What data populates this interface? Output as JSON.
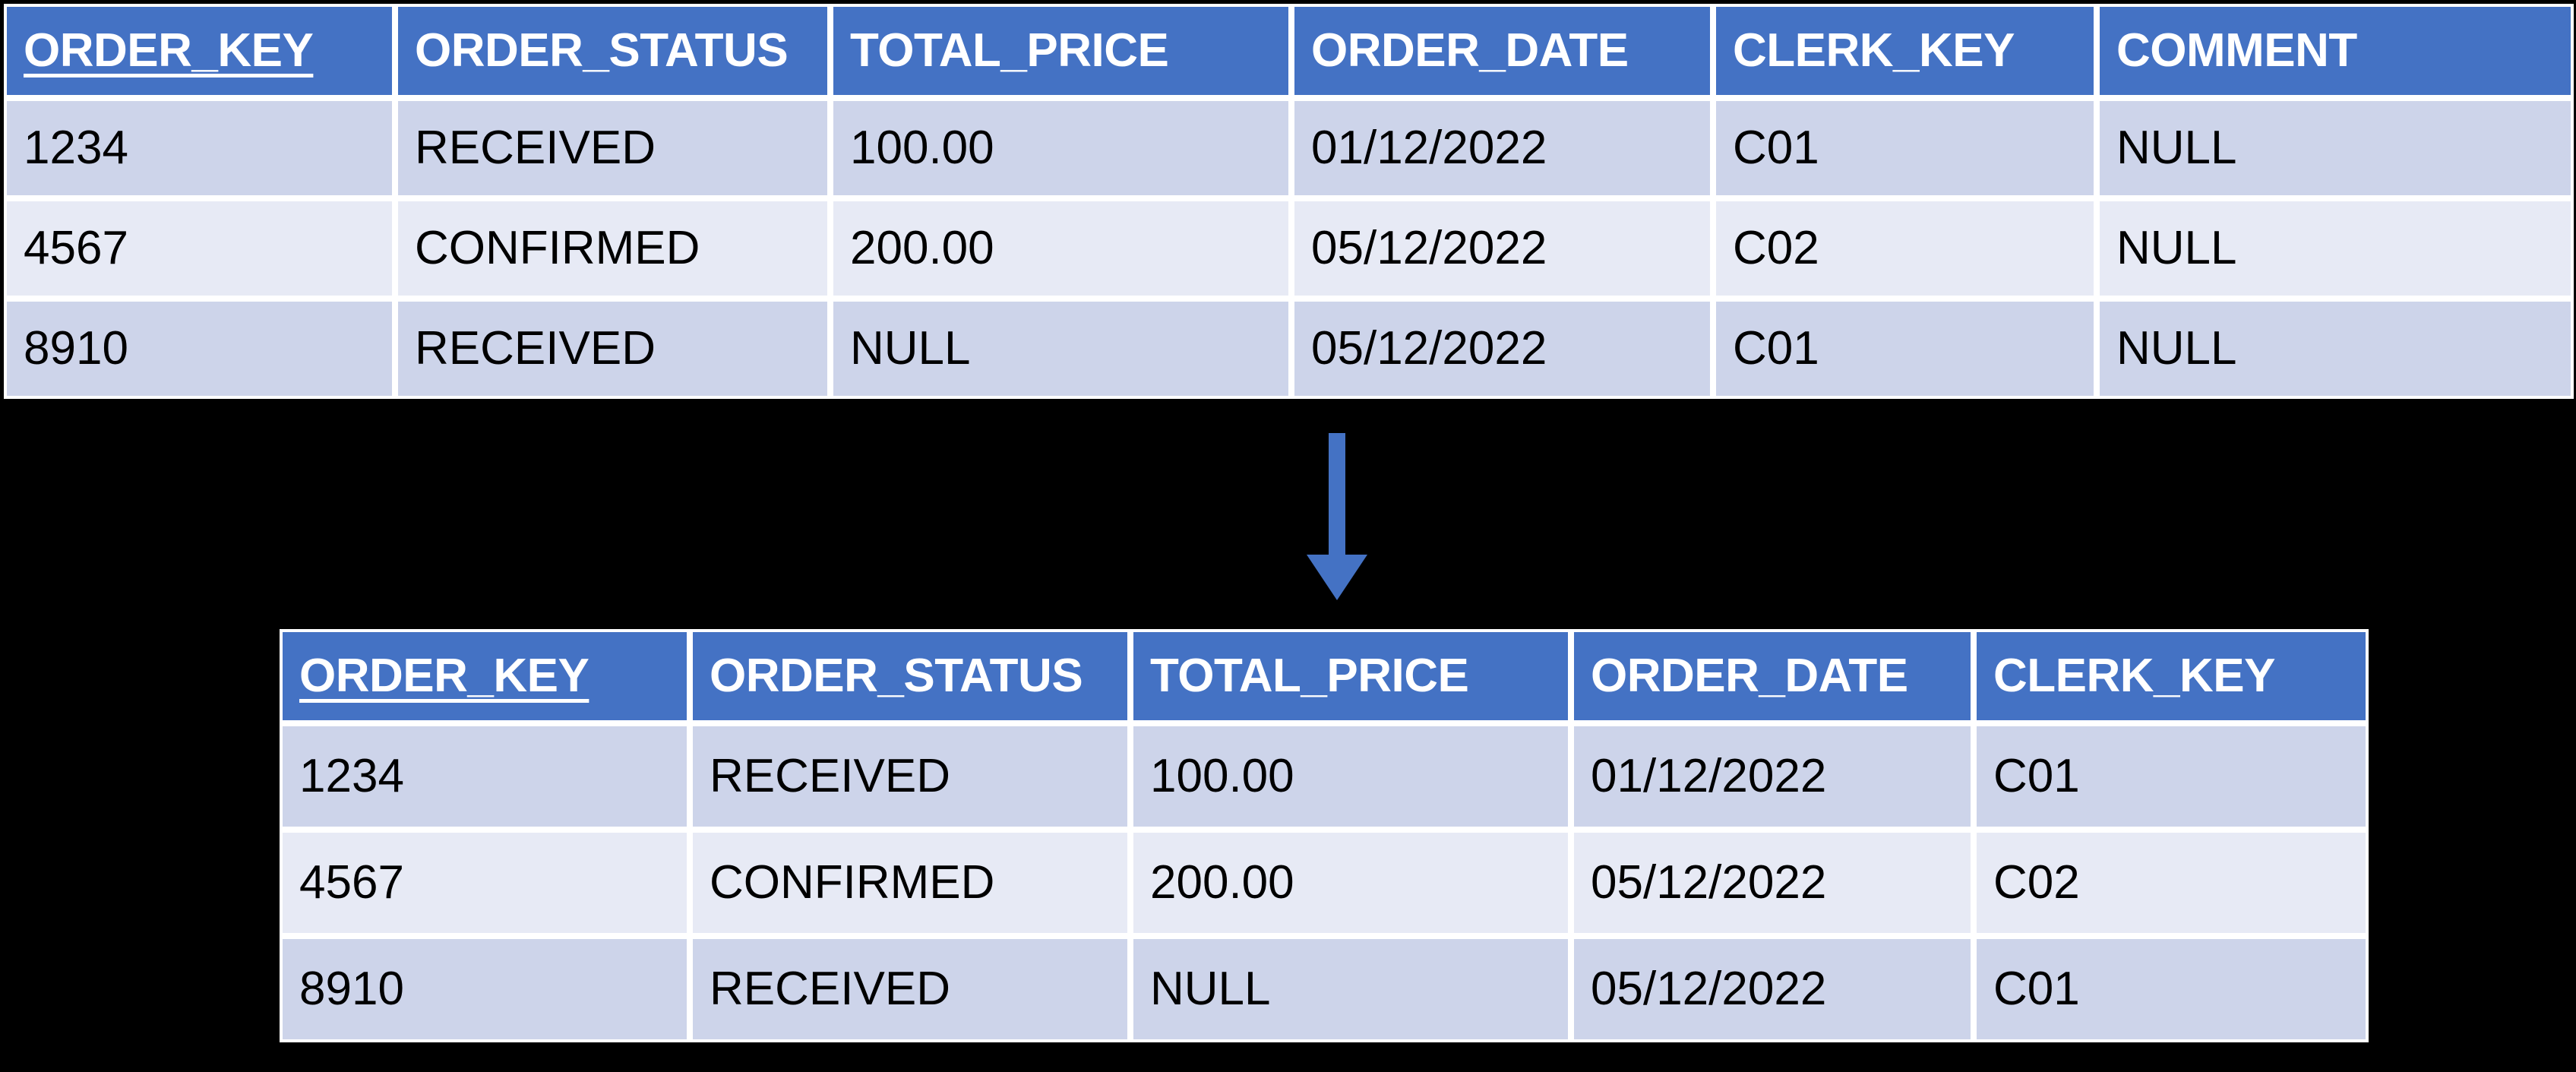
{
  "diagram": {
    "arrow": {
      "icon": "arrow-down-icon",
      "direction": "down",
      "color": "#4472C4"
    },
    "colors": {
      "background": "#000000",
      "header_fill": "#4472C4",
      "header_text": "#FFFFFF",
      "row_odd_fill": "#CDD4EA",
      "row_even_fill": "#E7EAF5",
      "cell_text": "#000000",
      "cell_gap": "#FFFFFF"
    }
  },
  "top_table": {
    "columns": [
      "ORDER_KEY",
      "ORDER_STATUS",
      "TOTAL_PRICE",
      "ORDER_DATE",
      "CLERK_KEY",
      "COMMENT"
    ],
    "primary_key_column": "ORDER_KEY",
    "rows": [
      [
        "1234",
        "RECEIVED",
        "100.00",
        "01/12/2022",
        "C01",
        "NULL"
      ],
      [
        "4567",
        "CONFIRMED",
        "200.00",
        "05/12/2022",
        "C02",
        "NULL"
      ],
      [
        "8910",
        "RECEIVED",
        "NULL",
        "05/12/2022",
        "C01",
        "NULL"
      ]
    ]
  },
  "bottom_table": {
    "columns": [
      "ORDER_KEY",
      "ORDER_STATUS",
      "TOTAL_PRICE",
      "ORDER_DATE",
      "CLERK_KEY"
    ],
    "primary_key_column": "ORDER_KEY",
    "rows": [
      [
        "1234",
        "RECEIVED",
        "100.00",
        "01/12/2022",
        "C01"
      ],
      [
        "4567",
        "CONFIRMED",
        "200.00",
        "05/12/2022",
        "C02"
      ],
      [
        "8910",
        "RECEIVED",
        "NULL",
        "05/12/2022",
        "C01"
      ]
    ]
  }
}
